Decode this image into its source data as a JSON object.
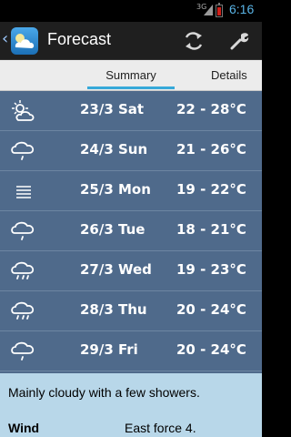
{
  "status_bar": {
    "network": "3G",
    "time": "6:16"
  },
  "action_bar": {
    "title": "Forecast",
    "icons": {
      "app": "weather-app-icon",
      "refresh": "refresh-icon",
      "settings": "wrench-icon"
    }
  },
  "tabs": [
    {
      "label": "Summary",
      "selected": true
    },
    {
      "label": "Details",
      "selected": false
    }
  ],
  "forecast": [
    {
      "icon": "partly-cloudy-icon",
      "date": "23/3",
      "day": "Sat",
      "temp": "22 - 28°C"
    },
    {
      "icon": "rain-cloud-icon",
      "date": "24/3",
      "day": "Sun",
      "temp": "21 - 26°C"
    },
    {
      "icon": "fog-icon",
      "date": "25/3",
      "day": "Mon",
      "temp": "19 - 22°C"
    },
    {
      "icon": "rain-cloud-icon",
      "date": "26/3",
      "day": "Tue",
      "temp": "18 - 21°C"
    },
    {
      "icon": "showers-icon",
      "date": "27/3",
      "day": "Wed",
      "temp": "19 - 23°C"
    },
    {
      "icon": "showers-icon",
      "date": "28/3",
      "day": "Thu",
      "temp": "20 - 24°C"
    },
    {
      "icon": "rain-cloud-icon",
      "date": "29/3",
      "day": "Fri",
      "temp": "20 - 24°C"
    }
  ],
  "details": {
    "summary": "Mainly cloudy with a few showers.",
    "wind_label": "Wind",
    "wind_value": "East force 4."
  },
  "colors": {
    "status_time": "#5ab4e6",
    "action_bar": "#1f1f1f",
    "tab_indicator": "#37a9d9",
    "list_background": "#4f6a8b",
    "details_background": "#b8d7e9"
  }
}
